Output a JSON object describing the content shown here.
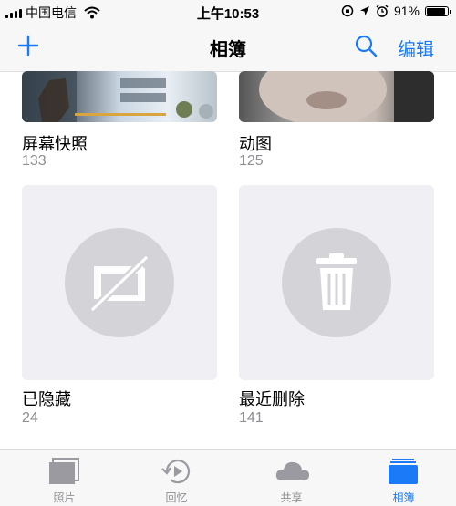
{
  "status_bar": {
    "carrier": "中国电信",
    "time": "上午10:53",
    "battery_percent": "91%",
    "battery_level": 0.91
  },
  "nav": {
    "title": "相簿",
    "edit_label": "编辑",
    "icons": {
      "add": "plus-icon",
      "search": "search-icon"
    }
  },
  "albums": [
    {
      "name": "屏幕快照",
      "count": "133"
    },
    {
      "name": "动图",
      "count": "125"
    },
    {
      "name": "已隐藏",
      "count": "24"
    },
    {
      "name": "最近删除",
      "count": "141"
    }
  ],
  "tabs": [
    {
      "label": "照片",
      "icon": "photos-icon",
      "active": false
    },
    {
      "label": "回忆",
      "icon": "memories-icon",
      "active": false
    },
    {
      "label": "共享",
      "icon": "cloud-icon",
      "active": false
    },
    {
      "label": "相簿",
      "icon": "albums-icon",
      "active": true
    }
  ],
  "colors": {
    "accent": "#1a7af8",
    "secondary_text": "#8e8e93",
    "placeholder_bg": "#efeff4"
  }
}
